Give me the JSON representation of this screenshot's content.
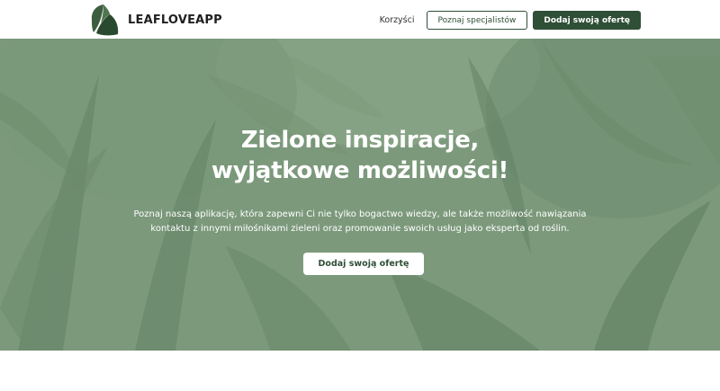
{
  "brand": {
    "name": "LEAFLOVEAPP"
  },
  "nav": {
    "link_benefits": "Korzyści",
    "btn_specialists": "Poznaj specjalistów",
    "btn_add_offer": "Dodaj swoją ofertę"
  },
  "hero": {
    "title_line1": "Zielone inspiracje,",
    "title_line2": "wyjątkowe możliwości!",
    "description": "Poznaj naszą aplikację, która zapewni Ci nie tylko bogactwo wiedzy, ale także możliwość nawiązania kontaktu z innymi miłośnikami zieleni oraz promowanie swoich usług jako eksperta od roślin.",
    "cta": "Dodaj swoją ofertę"
  },
  "colors": {
    "brand_dark_green": "#2f4f37",
    "hero_tint": "#83a085"
  },
  "icons": {
    "logo": "leaf-logo-icon"
  }
}
